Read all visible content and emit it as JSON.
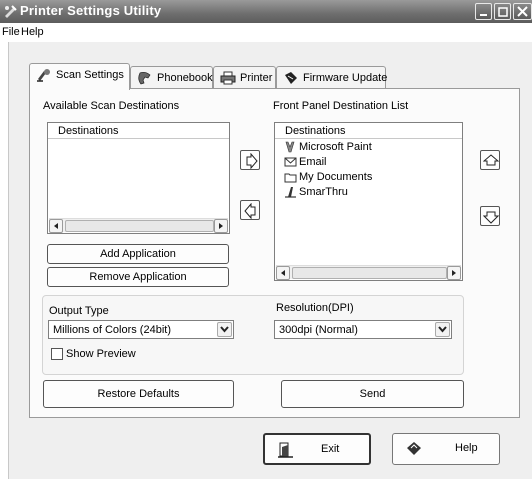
{
  "window": {
    "title": "Printer Settings Utility"
  },
  "menu": {
    "file": "File",
    "help": "Help"
  },
  "tabs": [
    {
      "label": "Scan Settings",
      "icon": "scanner-icon",
      "active": true
    },
    {
      "label": "Phonebook",
      "icon": "phonebook-icon",
      "active": false
    },
    {
      "label": "Printer",
      "icon": "printer-icon",
      "active": false
    },
    {
      "label": "Firmware Update",
      "icon": "firmware-icon",
      "active": false
    }
  ],
  "scan": {
    "available_label": "Available Scan Destinations",
    "front_panel_label": "Front Panel Destination List",
    "available_header": "Destinations",
    "front_header": "Destinations",
    "front_items": [
      {
        "label": "Microsoft Paint",
        "icon": "paint-icon"
      },
      {
        "label": "Email",
        "icon": "email-icon"
      },
      {
        "label": "My Documents",
        "icon": "folder-icon"
      },
      {
        "label": "SmarThru",
        "icon": "smarthru-icon"
      }
    ],
    "add_application": "Add Application",
    "remove_application": "Remove Application",
    "output_type_label": "Output Type",
    "output_type_value": "Millions of Colors (24bit)",
    "resolution_label": "Resolution(DPI)",
    "resolution_value": "300dpi (Normal)",
    "show_preview": "Show Preview",
    "show_preview_checked": false,
    "restore_defaults": "Restore Defaults",
    "send": "Send"
  },
  "footer": {
    "exit": "Exit",
    "help": "Help"
  }
}
